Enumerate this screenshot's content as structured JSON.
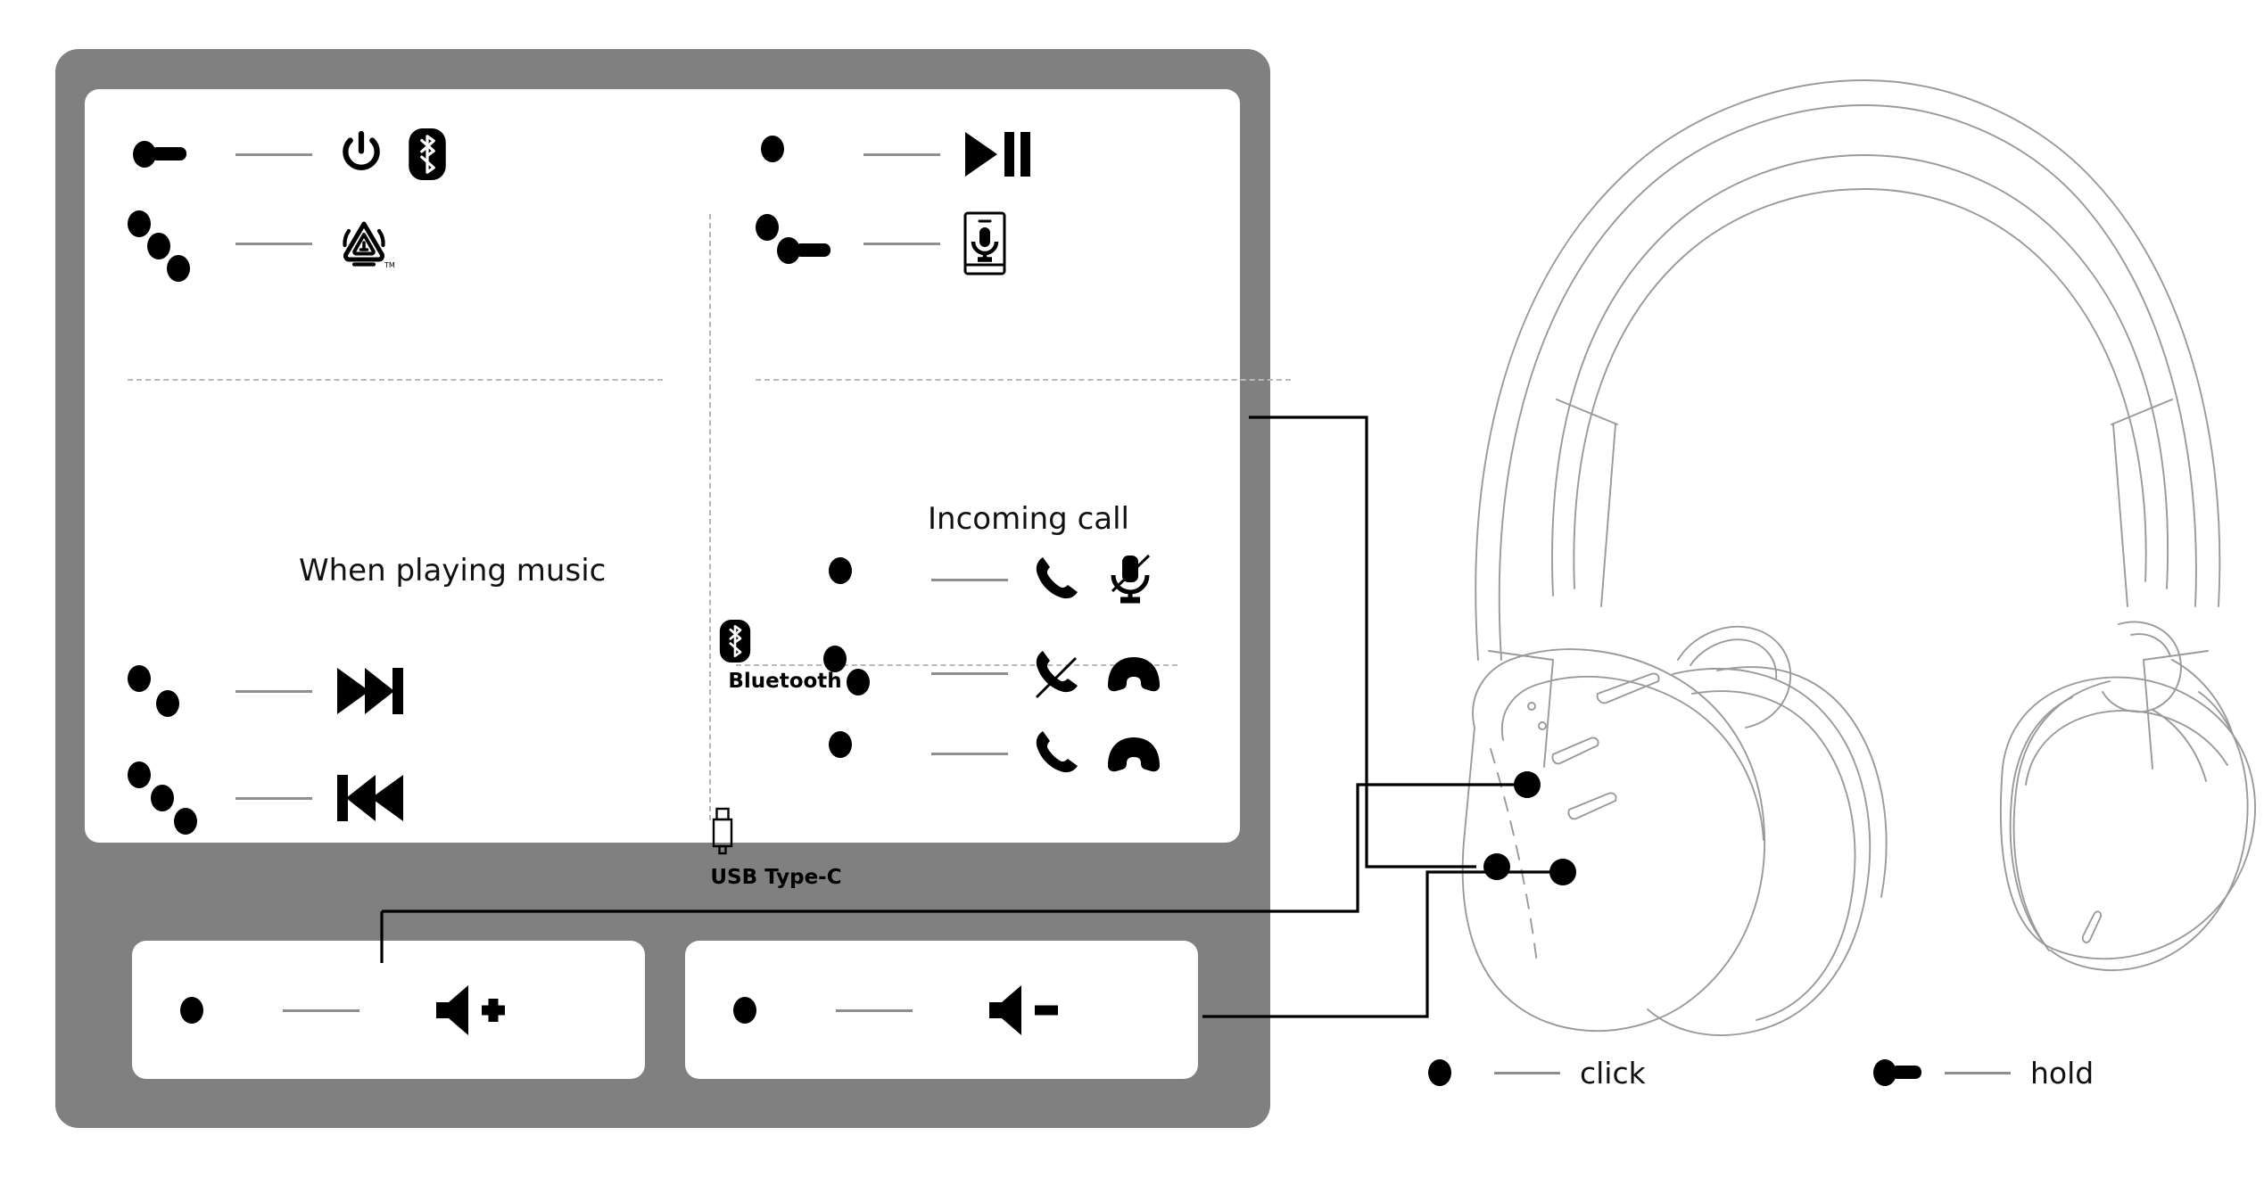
{
  "diagram": {
    "title": "Headphone button controls",
    "device_color": "#808080",
    "card_color": "#ffffff",
    "line_color": "#8e8e8e"
  },
  "sections": {
    "power_bt": {
      "rows": [
        {
          "gesture": "hold",
          "clicks": 1,
          "hold": true,
          "icons": [
            "power-icon",
            "bluetooth-icon"
          ],
          "action": "Power on / Bluetooth pairing"
        },
        {
          "gesture": "click-x3",
          "clicks": 3,
          "hold": false,
          "icons": [
            "auracast-icon"
          ],
          "action": "Auracast"
        }
      ]
    },
    "playback": {
      "rows": [
        {
          "gesture": "click",
          "clicks": 1,
          "hold": false,
          "icons": [
            "play-pause-icon"
          ],
          "action": "Play / Pause"
        },
        {
          "gesture": "click-hold",
          "clicks": 2,
          "hold": true,
          "icons": [
            "phone-voice-assistant-icon"
          ],
          "action": "Voice assistant"
        }
      ]
    },
    "music": {
      "heading": "When playing music",
      "rows": [
        {
          "gesture": "click-x2",
          "clicks": 2,
          "hold": false,
          "icons": [
            "next-track-icon"
          ],
          "action": "Next track"
        },
        {
          "gesture": "click-x3",
          "clicks": 3,
          "hold": false,
          "icons": [
            "previous-track-icon"
          ],
          "action": "Previous track"
        }
      ]
    },
    "incoming_call": {
      "heading": "Incoming call",
      "sources": [
        {
          "label": "Bluetooth",
          "icon": "bluetooth-icon"
        },
        {
          "label": "USB Type-C",
          "icon": "usb-type-c-icon"
        }
      ],
      "bluetooth_rows": [
        {
          "gesture": "click",
          "clicks": 1,
          "hold": false,
          "icons": [
            "answer-call-icon",
            "mic-mute-icon"
          ],
          "action": "Answer call / Mute microphone"
        },
        {
          "gesture": "click-x2",
          "clicks": 2,
          "hold": false,
          "icons": [
            "reject-call-icon",
            "hang-up-icon"
          ],
          "action": "Reject call / Hang up"
        }
      ],
      "usb_rows": [
        {
          "gesture": "click",
          "clicks": 1,
          "hold": false,
          "icons": [
            "answer-call-icon",
            "hang-up-icon"
          ],
          "action": "Answer call / Hang up"
        }
      ]
    },
    "volume_up": {
      "row": {
        "gesture": "click",
        "clicks": 1,
        "hold": false,
        "icons": [
          "volume-up-icon"
        ],
        "action": "Volume up"
      }
    },
    "volume_down": {
      "row": {
        "gesture": "click",
        "clicks": 1,
        "hold": false,
        "icons": [
          "volume-down-icon"
        ],
        "action": "Volume down"
      }
    }
  },
  "legend": {
    "items": [
      {
        "symbol": "click",
        "label": "click"
      },
      {
        "symbol": "hold",
        "label": "hold"
      }
    ]
  },
  "product": {
    "illustration": "over-ear-headphones-line-art",
    "callout_count": 3
  }
}
